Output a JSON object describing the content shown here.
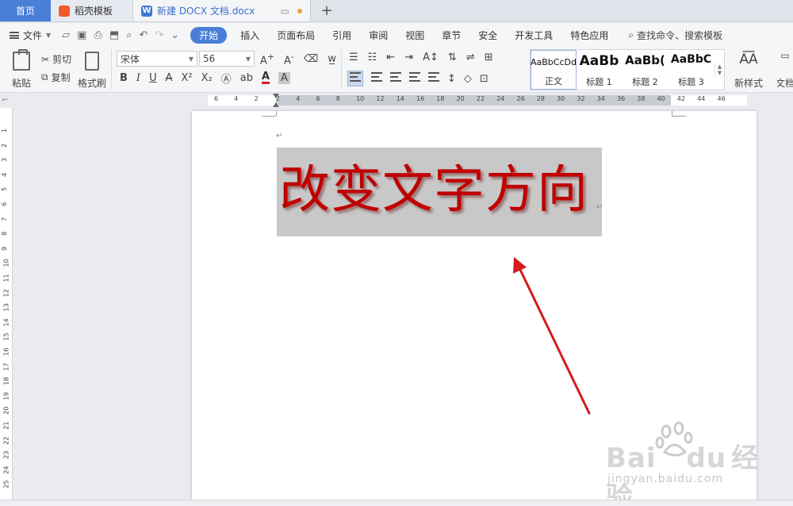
{
  "tabs": {
    "home": "首页",
    "template": "稻壳模板",
    "document": "新建 DOCX 文档.docx",
    "add": "+"
  },
  "menu": {
    "file": "文件",
    "items": [
      "开始",
      "插入",
      "页面布局",
      "引用",
      "审阅",
      "视图",
      "章节",
      "安全",
      "开发工具",
      "特色应用"
    ],
    "active": "开始",
    "search": "查找命令、搜索模板"
  },
  "ribbon": {
    "paste": "粘贴",
    "cut": "剪切",
    "copy": "复制",
    "format_painter": "格式刷",
    "font_name": "宋体",
    "font_size": "56",
    "bold": "B",
    "italic": "I",
    "underline": "U",
    "styles": [
      {
        "sample": "AaBbCcDd",
        "label": "正文"
      },
      {
        "sample": "AaBb",
        "label": "标题 1"
      },
      {
        "sample": "AaBb(",
        "label": "标题 2"
      },
      {
        "sample": "AaBbC",
        "label": "标题 3"
      }
    ],
    "new_style": "新样式",
    "new_style_glyph": "A͞A",
    "wen": "文档"
  },
  "ruler": {
    "h_labels": [
      "6",
      "4",
      "2",
      "2",
      "4",
      "6",
      "8",
      "10",
      "12",
      "14",
      "16",
      "18",
      "20",
      "22",
      "24",
      "26",
      "28",
      "30",
      "32",
      "34",
      "36",
      "38",
      "40",
      "42",
      "44",
      "46"
    ],
    "v_labels": [
      "1",
      "2",
      "3",
      "4",
      "5",
      "6",
      "7",
      "8",
      "9",
      "10",
      "11",
      "12",
      "13",
      "14",
      "15",
      "16",
      "17",
      "18",
      "19",
      "20",
      "21",
      "22",
      "23",
      "24",
      "25"
    ]
  },
  "document": {
    "paragraph_mark": "↵",
    "heading_text": "改变文字方向"
  },
  "watermark": {
    "brand": "Bai",
    "brand2": "du",
    "brand_cn": "经验",
    "url": "jingyan.baidu.com"
  },
  "colors": {
    "accent": "#4a7fd7",
    "heading_red": "#c00000",
    "arrow_red": "#d41c1c"
  }
}
